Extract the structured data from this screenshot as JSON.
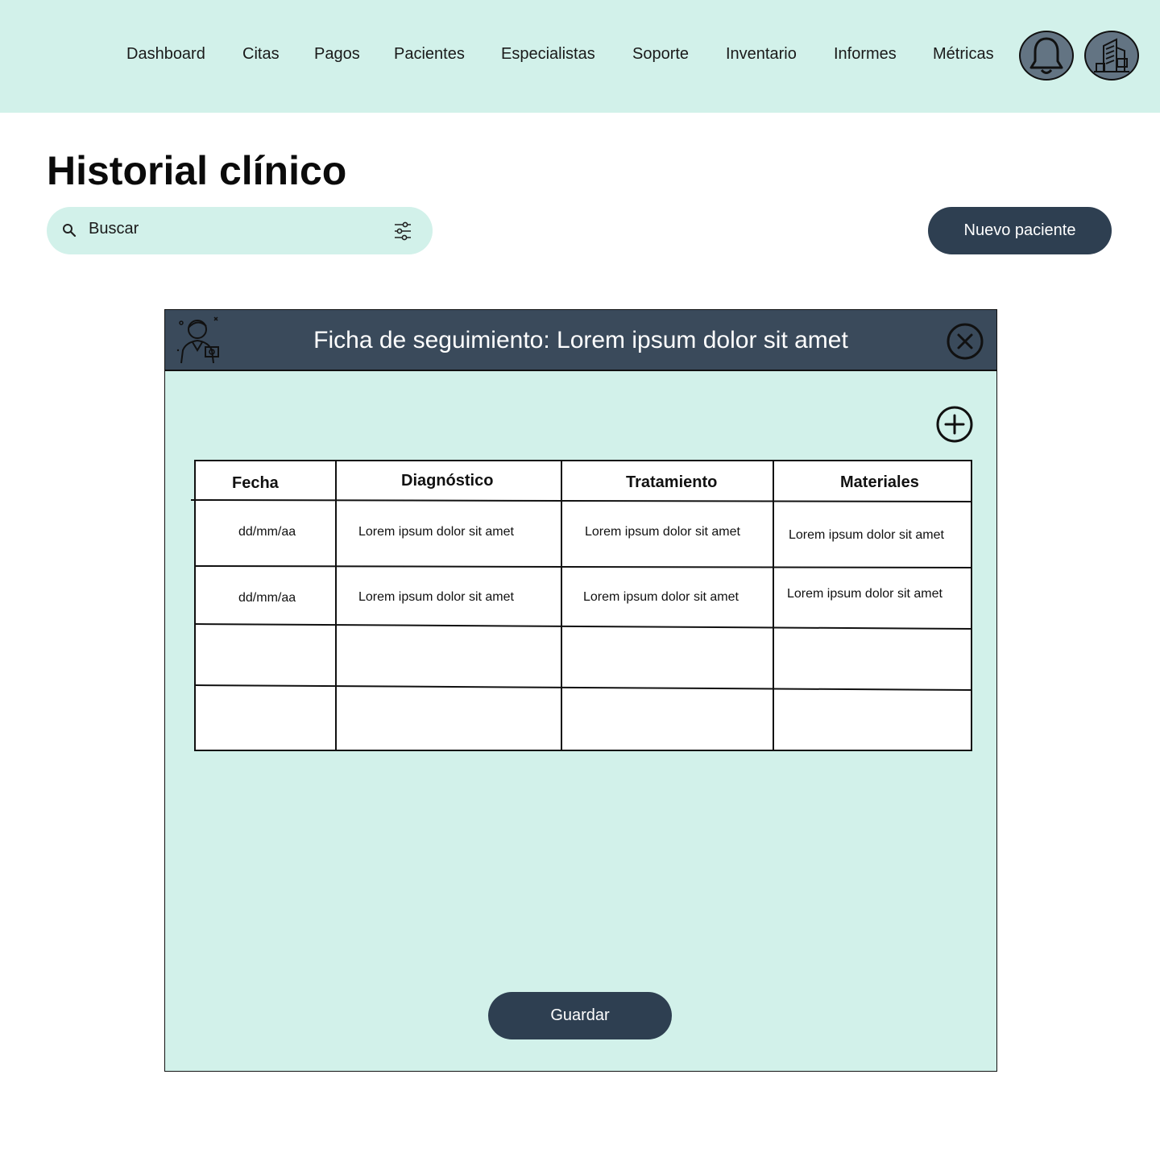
{
  "nav": {
    "items": [
      {
        "label": "Dashboard"
      },
      {
        "label": "Citas"
      },
      {
        "label": "Pagos"
      },
      {
        "label": "Pacientes"
      },
      {
        "label": "Especialistas"
      },
      {
        "label": "Soporte"
      },
      {
        "label": "Inventario"
      },
      {
        "label": "Informes"
      },
      {
        "label": "Métricas"
      }
    ],
    "actions": [
      "bell-icon",
      "building-icon"
    ]
  },
  "page": {
    "title": "Historial clínico"
  },
  "search": {
    "value": "Buscar",
    "icon": "search-icon",
    "filter_icon": "sliders-icon"
  },
  "new_patient_label": "Nuevo paciente",
  "modal": {
    "title": "Ficha de seguimiento: Lorem ipsum dolor sit amet",
    "header_icon": "doctor-icon",
    "close_icon": "close-icon",
    "add_icon": "plus-icon",
    "table": {
      "headers": [
        "Fecha",
        "Diagnóstico",
        "Tratamiento",
        "Materiales"
      ],
      "rows": [
        [
          "dd/mm/aa",
          "Lorem ipsum dolor sit amet",
          "Lorem ipsum dolor sit amet",
          "Lorem ipsum dolor sit amet"
        ],
        [
          "dd/mm/aa",
          "Lorem ipsum dolor sit amet",
          "Lorem ipsum dolor sit amet",
          "Lorem ipsum dolor sit amet"
        ],
        [
          "",
          "",
          "",
          ""
        ],
        [
          "",
          "",
          "",
          ""
        ]
      ]
    },
    "save_label": "Guardar"
  },
  "colors": {
    "mint": "#d2f1ea",
    "navy": "#2e3f51",
    "header": "#3a4a5b",
    "icon_fill": "#637483"
  }
}
